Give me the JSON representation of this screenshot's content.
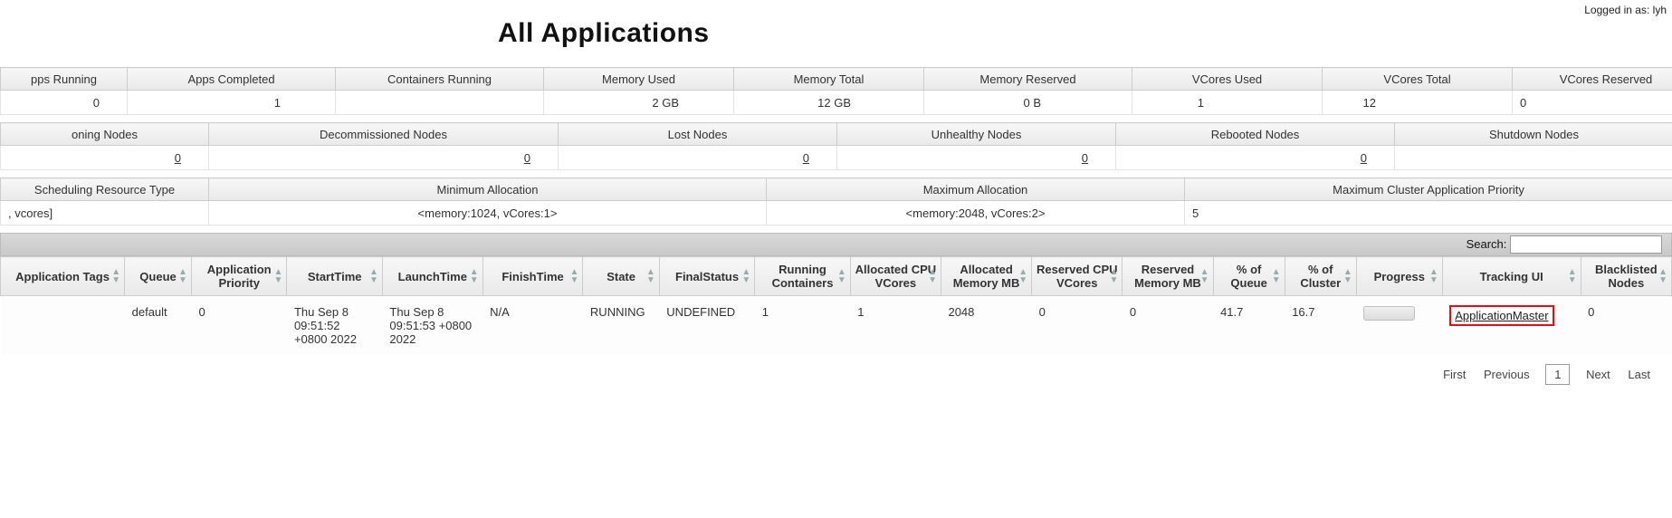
{
  "logged_in_prefix": "Logged in as: ",
  "logged_in_user": "lyh",
  "page_title": "All Applications",
  "metrics1": {
    "headers": [
      "pps Running",
      "Apps Completed",
      "Containers Running",
      "Memory Used",
      "Memory Total",
      "Memory Reserved",
      "VCores Used",
      "VCores Total",
      "VCores Reserved"
    ],
    "values": [
      "0",
      "1",
      "2 GB",
      "12 GB",
      "0 B",
      "1",
      "12",
      "0",
      ""
    ],
    "values_raw": [
      "0",
      "1",
      "",
      "2 GB",
      "12 GB",
      "0 B",
      "1",
      "12",
      "0"
    ]
  },
  "metrics2": {
    "headers": [
      "oning Nodes",
      "Decommissioned Nodes",
      "Lost Nodes",
      "Unhealthy Nodes",
      "Rebooted Nodes",
      "Shutdown Nodes"
    ],
    "values": [
      "0",
      "0",
      "0",
      "0",
      "0",
      ""
    ]
  },
  "metrics3": {
    "headers": [
      "Scheduling Resource Type",
      "Minimum Allocation",
      "Maximum Allocation",
      "Maximum Cluster Application Priority"
    ],
    "values": [
      ", vcores]",
      "<memory:1024, vCores:1>",
      "<memory:2048, vCores:2>",
      "5"
    ]
  },
  "search_label": "Search:",
  "apps_headers": [
    "Application Tags",
    "Queue",
    "Application Priority",
    "StartTime",
    "LaunchTime",
    "FinishTime",
    "State",
    "FinalStatus",
    "Running Containers",
    "Allocated CPU VCores",
    "Allocated Memory MB",
    "Reserved CPU VCores",
    "Reserved Memory MB",
    "% of Queue",
    "% of Cluster",
    "Progress",
    "Tracking UI",
    "Blacklisted Nodes"
  ],
  "row": {
    "tags": "",
    "queue": "default",
    "priority": "0",
    "start": "Thu Sep 8 09:51:52 +0800 2022",
    "launch": "Thu Sep 8 09:51:53 +0800 2022",
    "finish": "N/A",
    "state": "RUNNING",
    "final": "UNDEFINED",
    "running_containers": "1",
    "alloc_vcores": "1",
    "alloc_mem": "2048",
    "res_vcores": "0",
    "res_mem": "0",
    "pct_queue": "41.7",
    "pct_cluster": "16.7",
    "tracking": "ApplicationMaster",
    "blacklisted": "0"
  },
  "paging": {
    "first": "First",
    "prev": "Previous",
    "page": "1",
    "next": "Next",
    "last": "Last"
  }
}
